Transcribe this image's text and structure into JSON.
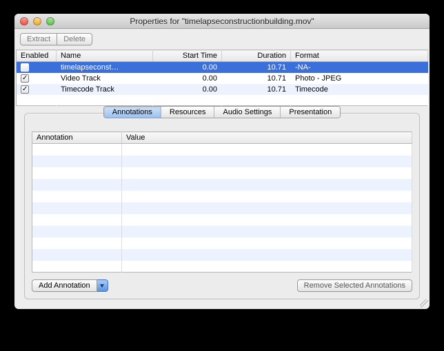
{
  "window": {
    "title": "Properties for \"timelapseconstructionbuilding.mov\""
  },
  "toolbar": {
    "extract_label": "Extract",
    "delete_label": "Delete"
  },
  "track_table": {
    "headers": {
      "enabled": "Enabled",
      "name": "Name",
      "start": "Start Time",
      "duration": "Duration",
      "format": "Format"
    },
    "rows": [
      {
        "enabled": false,
        "name": "timelapseconst…",
        "start": "0.00",
        "duration": "10.71",
        "format": "-NA-",
        "selected": true
      },
      {
        "enabled": true,
        "name": "Video Track",
        "start": "0.00",
        "duration": "10.71",
        "format": "Photo - JPEG",
        "selected": false
      },
      {
        "enabled": true,
        "name": "Timecode Track",
        "start": "0.00",
        "duration": "10.71",
        "format": "Timecode",
        "selected": false
      }
    ]
  },
  "tabs": {
    "items": [
      {
        "label": "Annotations",
        "active": true
      },
      {
        "label": "Resources",
        "active": false
      },
      {
        "label": "Audio Settings",
        "active": false
      },
      {
        "label": "Presentation",
        "active": false
      }
    ]
  },
  "annotations": {
    "headers": {
      "annotation": "Annotation",
      "value": "Value"
    },
    "add_label": "Add Annotation",
    "remove_label": "Remove Selected Annotations"
  }
}
